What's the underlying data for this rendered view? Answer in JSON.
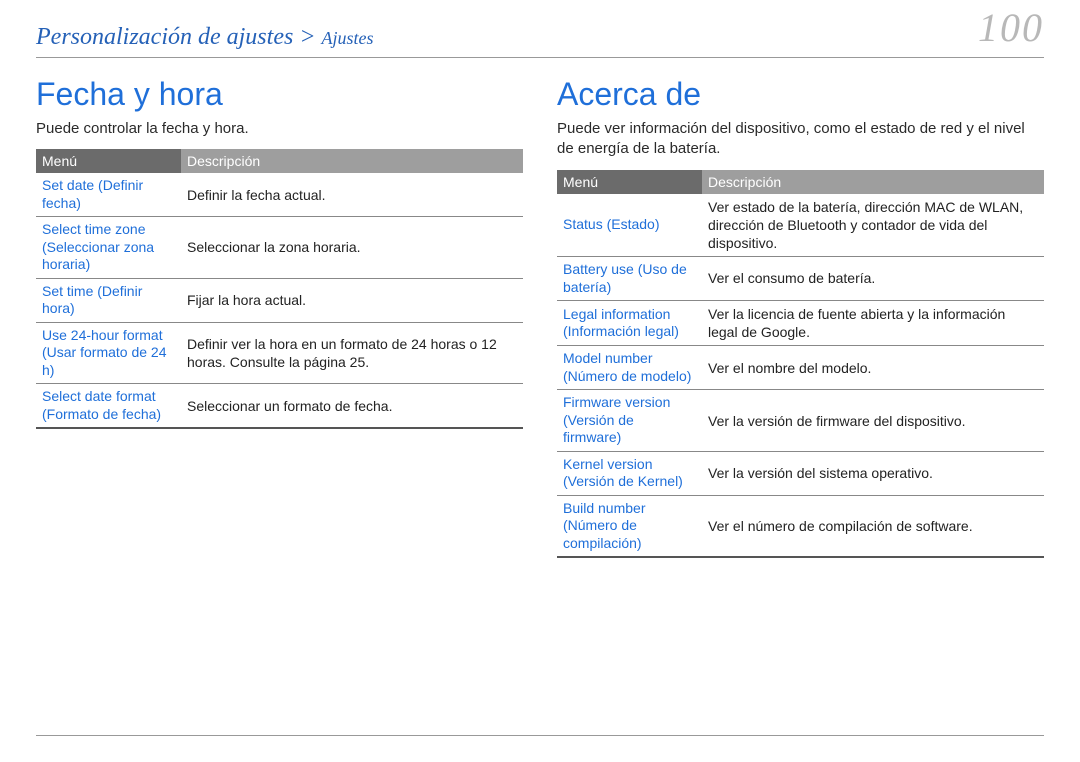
{
  "breadcrumb": {
    "section": "Personalización de ajustes",
    "sep": ">",
    "sub": "Ajustes"
  },
  "page_number": "100",
  "left": {
    "title": "Fecha y hora",
    "intro": "Puede controlar la fecha y hora.",
    "headers": {
      "menu": "Menú",
      "desc": "Descripción"
    },
    "rows": [
      {
        "menu": "Set date\n(Definir fecha)",
        "desc": "Definir la fecha actual."
      },
      {
        "menu": "Select time zone\n(Seleccionar zona horaria)",
        "desc": "Seleccionar la zona horaria."
      },
      {
        "menu": "Set time\n(Definir hora)",
        "desc": "Fijar la hora actual."
      },
      {
        "menu": "Use 24-hour format (Usar formato de 24 h)",
        "desc": "Definir ver la hora en un formato de 24 horas o 12 horas. Consulte la página 25."
      },
      {
        "menu": "Select date format\n(Formato de fecha)",
        "desc": "Seleccionar un formato de fecha."
      }
    ]
  },
  "right": {
    "title": "Acerca de",
    "intro": "Puede ver información del dispositivo, como el estado de red y el nivel de energía de la batería.",
    "headers": {
      "menu": "Menú",
      "desc": "Descripción"
    },
    "rows": [
      {
        "menu": "Status (Estado)",
        "desc": "Ver estado de la batería, dirección MAC de WLAN, dirección de Bluetooth y contador de vida del dispositivo."
      },
      {
        "menu": "Battery use\n(Uso de batería)",
        "desc": "Ver el consumo de batería."
      },
      {
        "menu": "Legal information\n(Información legal)",
        "desc": "Ver la licencia de fuente abierta y la información legal de Google."
      },
      {
        "menu": "Model number\n(Número de modelo)",
        "desc": "Ver el nombre del modelo."
      },
      {
        "menu": "Firmware version\n(Versión de firmware)",
        "desc": "Ver la versión de firmware del dispositivo."
      },
      {
        "menu": "Kernel version\n(Versión de Kernel)",
        "desc": "Ver la versión del sistema operativo."
      },
      {
        "menu": "Build number\n(Número de compilación)",
        "desc": "Ver el número de compilación de software."
      }
    ]
  }
}
